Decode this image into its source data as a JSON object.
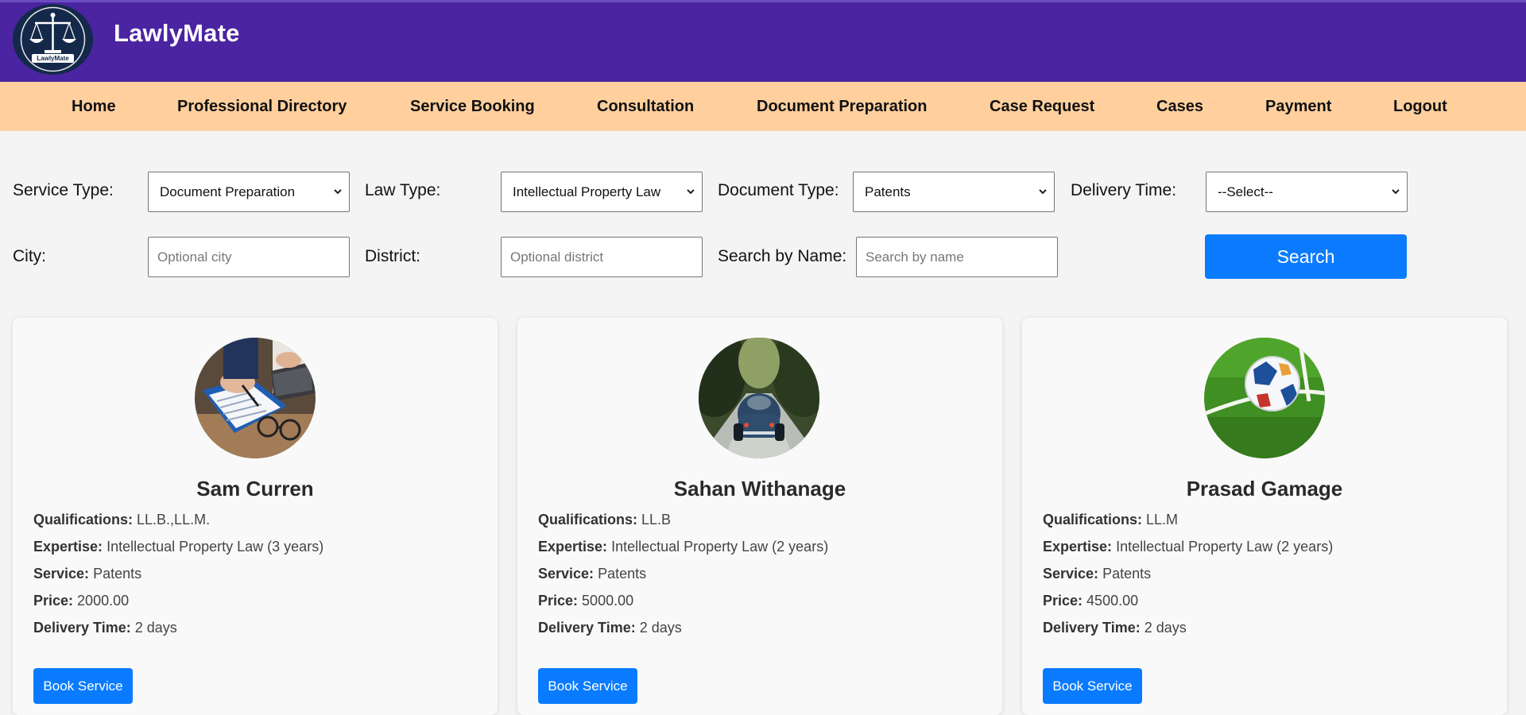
{
  "header": {
    "brand": "LawlyMate",
    "logo_text": "LawlyMate"
  },
  "nav": {
    "items": [
      "Home",
      "Professional Directory",
      "Service Booking",
      "Consultation",
      "Document Preparation",
      "Case Request",
      "Cases",
      "Payment",
      "Logout"
    ]
  },
  "filters": {
    "service_type": {
      "label": "Service Type:",
      "selected": "Document Preparation"
    },
    "law_type": {
      "label": "Law Type:",
      "selected": "Intellectual Property Law"
    },
    "document_type": {
      "label": "Document Type:",
      "selected": "Patents"
    },
    "delivery_time": {
      "label": "Delivery Time:",
      "selected": "--Select--"
    },
    "city": {
      "label": "City:",
      "placeholder": "Optional city",
      "value": ""
    },
    "district": {
      "label": "District:",
      "placeholder": "Optional district",
      "value": ""
    },
    "name": {
      "label": "Search by Name:",
      "placeholder": "Search by name",
      "value": ""
    },
    "search_label": "Search"
  },
  "labels": {
    "qualifications": "Qualifications:",
    "expertise": "Expertise:",
    "service": "Service:",
    "price": "Price:",
    "delivery": "Delivery Time:",
    "book": "Book Service"
  },
  "professionals": [
    {
      "name": "Sam Curren",
      "qualifications": "LL.B.,LL.M.",
      "expertise": "Intellectual Property Law (3 years)",
      "service": "Patents",
      "price": "2000.00",
      "delivery": "2 days",
      "photo_icon": "signing-document-photo"
    },
    {
      "name": "Sahan Withanage",
      "qualifications": "LL.B",
      "expertise": "Intellectual Property Law (2 years)",
      "service": "Patents",
      "price": "5000.00",
      "delivery": "2 days",
      "photo_icon": "car-on-road-photo"
    },
    {
      "name": "Prasad Gamage",
      "qualifications": "LL.M",
      "expertise": "Intellectual Property Law (2 years)",
      "service": "Patents",
      "price": "4500.00",
      "delivery": "2 days",
      "photo_icon": "soccer-ball-photo"
    }
  ],
  "colors": {
    "header": "#4b24a1",
    "nav": "#ffd09e",
    "accent": "#0a7bff",
    "background": "#f4f4f4"
  }
}
